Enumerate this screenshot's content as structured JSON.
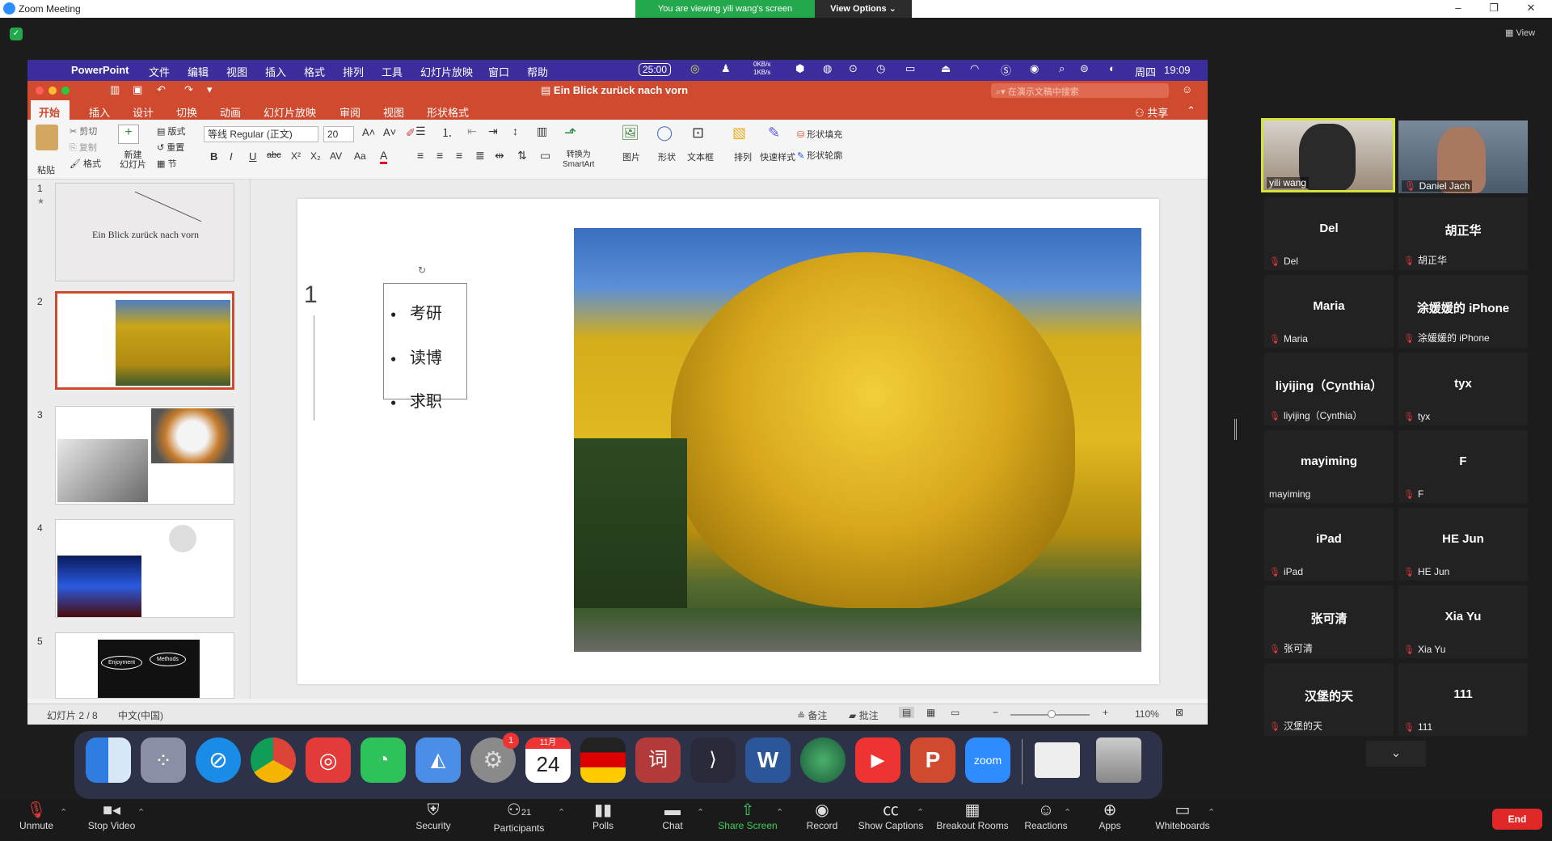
{
  "zoom": {
    "window_title": "Zoom Meeting",
    "viewing_banner": "You are viewing yili wang's screen",
    "view_options": "View Options ⌄",
    "view_label": "View",
    "toolbar": {
      "unmute": "Unmute",
      "stop_video": "Stop Video",
      "security": "Security",
      "participants": "Participants",
      "participants_count": "21",
      "polls": "Polls",
      "chat": "Chat",
      "share_screen": "Share Screen",
      "record": "Record",
      "show_captions": "Show Captions",
      "breakout_rooms": "Breakout Rooms",
      "reactions": "Reactions",
      "apps": "Apps",
      "whiteboards": "Whiteboards",
      "end": "End"
    },
    "participants": [
      {
        "tile_name": "",
        "label": "yili wang",
        "video": true,
        "muted": false
      },
      {
        "tile_name": "",
        "label": "Daniel Jach",
        "video": true,
        "muted": true
      },
      {
        "tile_name": "Del",
        "label": "Del",
        "muted": true
      },
      {
        "tile_name": "胡正华",
        "label": "胡正华",
        "muted": true
      },
      {
        "tile_name": "Maria",
        "label": "Maria",
        "muted": true
      },
      {
        "tile_name": "涂媛媛的 iPhone",
        "label": "涂媛媛的 iPhone",
        "muted": true
      },
      {
        "tile_name": "liyijing（Cynthia）",
        "label": "liyijing（Cynthia）",
        "muted": true
      },
      {
        "tile_name": "tyx",
        "label": "tyx",
        "muted": true
      },
      {
        "tile_name": "mayiming",
        "label": "mayiming",
        "muted": false
      },
      {
        "tile_name": "F",
        "label": "F",
        "muted": true
      },
      {
        "tile_name": "iPad",
        "label": "iPad",
        "muted": true
      },
      {
        "tile_name": "HE Jun",
        "label": "HE Jun",
        "muted": true
      },
      {
        "tile_name": "张可清",
        "label": "张可清",
        "muted": true
      },
      {
        "tile_name": "Xia Yu",
        "label": "Xia Yu",
        "muted": true
      },
      {
        "tile_name": "汉堡的天",
        "label": "汉堡的天",
        "muted": true
      },
      {
        "tile_name": "111",
        "label": "111",
        "muted": true
      }
    ]
  },
  "mac": {
    "menu": [
      "PowerPoint",
      "文件",
      "编辑",
      "视图",
      "插入",
      "格式",
      "排列",
      "工具",
      "幻灯片放映",
      "窗口",
      "帮助"
    ],
    "timer": "25:00",
    "net_up": "0KB/s",
    "net_down": "1KB/s",
    "day": "周四",
    "time": "19:09"
  },
  "ppt": {
    "doc_title": "Ein Blick zurück nach vorn",
    "search_placeholder": "在演示文稿中搜索",
    "tabs": [
      "开始",
      "插入",
      "设计",
      "切换",
      "动画",
      "幻灯片放映",
      "审阅",
      "视图",
      "形状格式"
    ],
    "share": "共享",
    "ribbon": {
      "paste": "粘贴",
      "cut": "剪切",
      "copy": "复制",
      "format": "格式",
      "new_slide": "新建\n幻灯片",
      "layout": "版式",
      "reset": "重置",
      "section": "节",
      "font": "等线 Regular (正文)",
      "size": "20",
      "smartart": "转换为\nSmartArt",
      "picture": "图片",
      "shape": "形状",
      "textbox": "文本框",
      "arrange": "排列",
      "quick_styles": "快速样式",
      "shape_fill": "形状填充",
      "shape_outline": "形状轮廓"
    },
    "thumbs": [
      "1",
      "2",
      "3",
      "4",
      "5"
    ],
    "thumb1_title": "Ein Blick zurück nach vorn",
    "thumb5_labels": [
      "Enjoyment",
      "Methods"
    ],
    "slide": {
      "number": "1",
      "bullets": [
        "考研",
        "读博",
        "求职"
      ]
    },
    "status": {
      "slide_counter": "幻灯片 2 / 8",
      "language": "中文(中国)",
      "notes": "备注",
      "comments": "批注",
      "zoom": "110%"
    }
  },
  "dock": {
    "calendar_month": "11月",
    "calendar_day": "24",
    "settings_badge": "1",
    "zoom_label": "zoom"
  }
}
